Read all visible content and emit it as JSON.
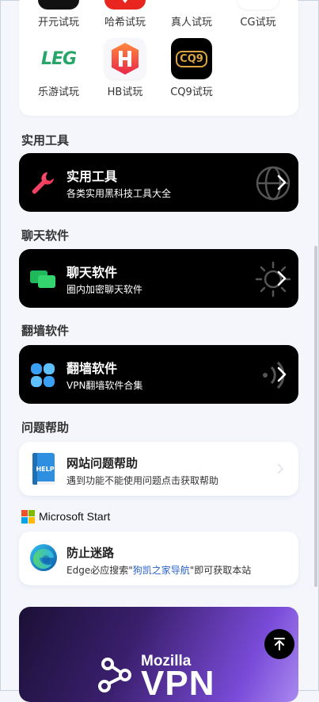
{
  "apps_row1": [
    {
      "label": "开元试玩",
      "icon": "kaiyuan-icon"
    },
    {
      "label": "哈希试玩",
      "icon": "haxi-icon"
    },
    {
      "label": "真人试玩",
      "icon": "zhenren-icon"
    },
    {
      "label": "CG试玩",
      "icon": "cg-icon"
    }
  ],
  "apps_row2": [
    {
      "label": "乐游试玩",
      "icon": "leg-icon",
      "logo_text": "LEG"
    },
    {
      "label": "HB试玩",
      "icon": "hb-icon",
      "logo_text": "H"
    },
    {
      "label": "CQ9试玩",
      "icon": "cq9-icon",
      "logo_text": "CQ9"
    }
  ],
  "sections": {
    "tools": {
      "heading": "实用工具",
      "card_title": "实用工具",
      "card_sub": "各类实用黑科技工具大全"
    },
    "chat": {
      "heading": "聊天软件",
      "card_title": "聊天软件",
      "card_sub": "圈内加密聊天软件"
    },
    "vpn": {
      "heading": "翻墙软件",
      "card_title": "翻墙软件",
      "card_sub": "VPN翻墙软件合集"
    },
    "help": {
      "heading": "问题帮助",
      "card_title": "网站问题帮助",
      "card_sub": "遇到功能不能使用问题点击获取帮助"
    }
  },
  "ms_start": {
    "brand": "Microsoft Start",
    "card_title": "防止迷路",
    "sub_before": "Edge必应搜索\"",
    "sub_link": "狗凯之家导航",
    "sub_after": "\"即可获取本站"
  },
  "banner": {
    "brand_top": "Mozilla",
    "brand_bottom": "VPN"
  },
  "colors": {
    "accent_link": "#2a62c9",
    "dark_card": "#000000",
    "page_bg": "#f4f6fb"
  }
}
